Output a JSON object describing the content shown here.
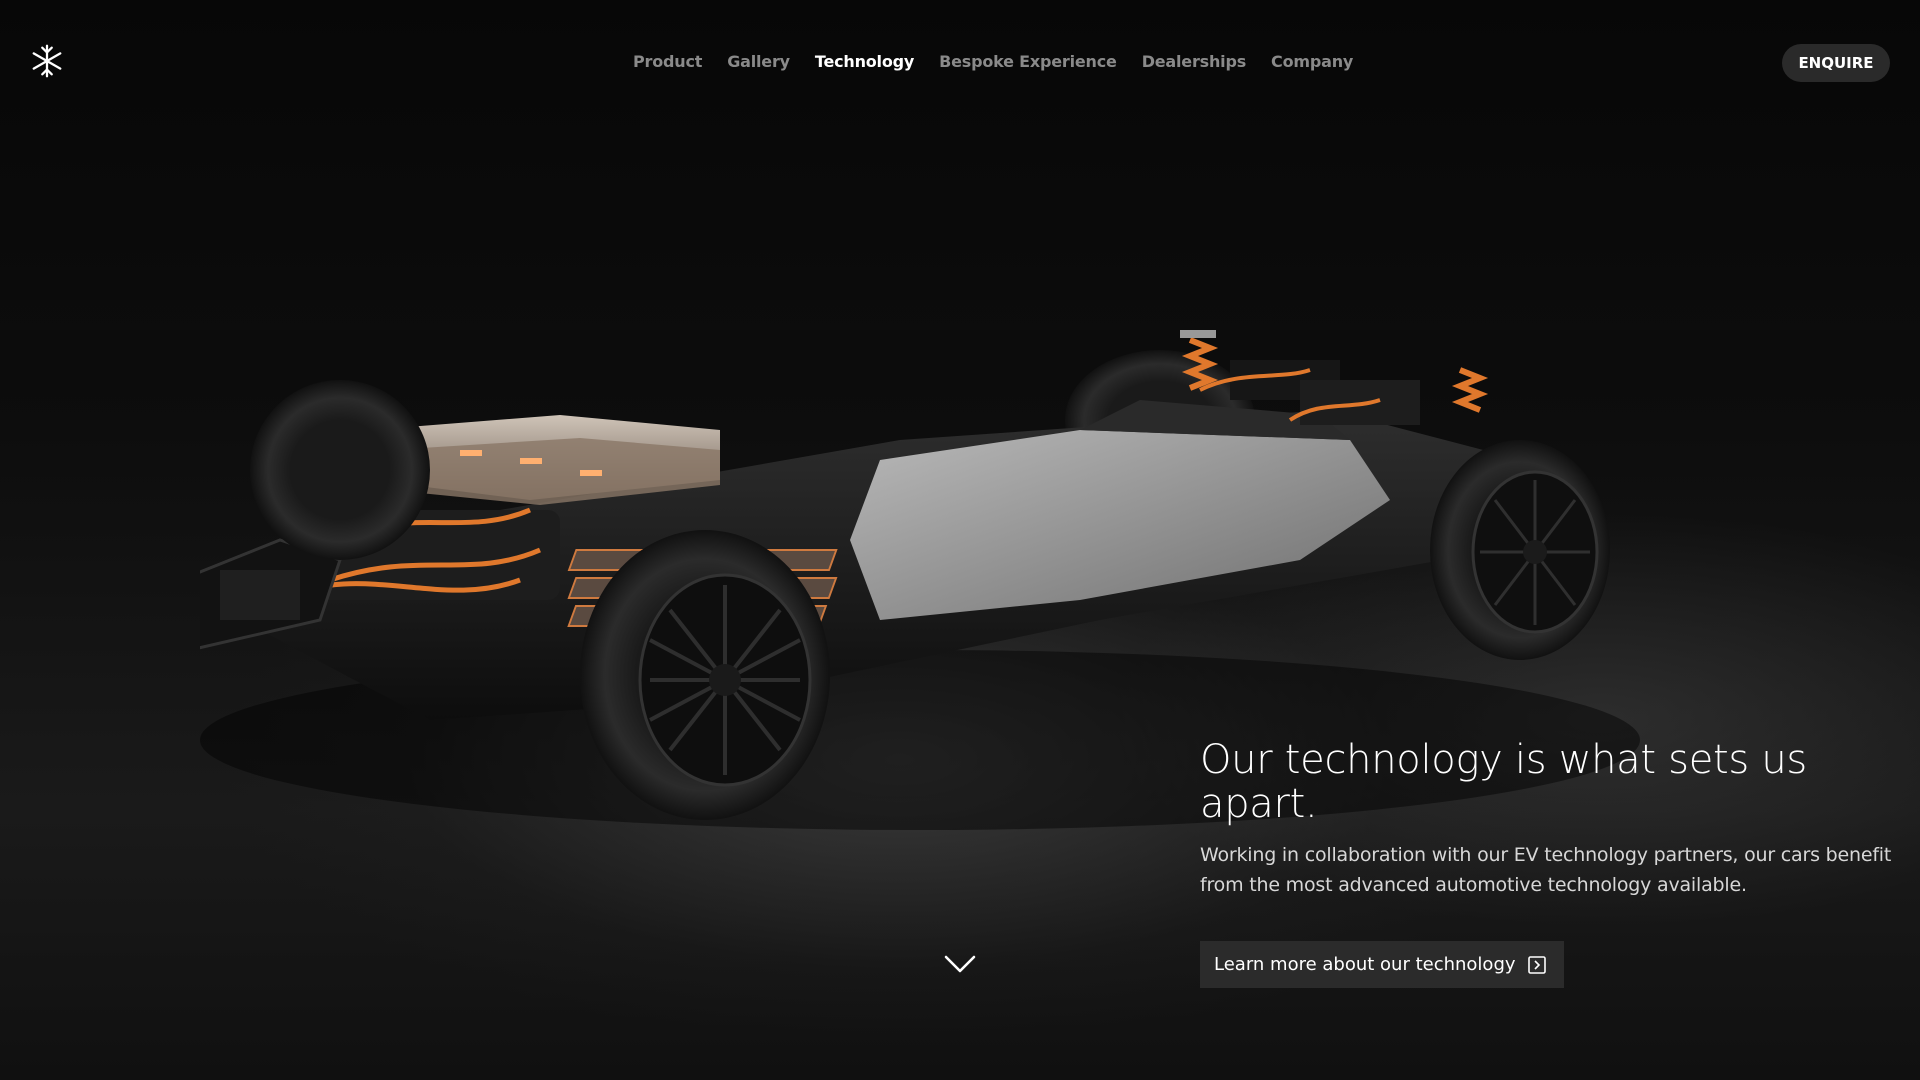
{
  "header": {
    "logo_icon": "snowflake-asterisk-logo-icon",
    "nav": [
      {
        "label": "Product",
        "active": false
      },
      {
        "label": "Gallery",
        "active": false
      },
      {
        "label": "Technology",
        "active": true
      },
      {
        "label": "Bespoke Experience",
        "active": false
      },
      {
        "label": "Dealerships",
        "active": false
      },
      {
        "label": "Company",
        "active": false
      }
    ],
    "enquire_label": "ENQUIRE"
  },
  "hero": {
    "headline": "Our technology is what sets us apart.",
    "subtext": "Working in collaboration with our EV technology partners, our cars benefit from the most advanced automotive technology available.",
    "cta_label": "Learn more about our technology",
    "cta_icon": "external-link-box-icon",
    "scroll_icon": "chevron-down-icon"
  },
  "colors": {
    "background": "#0b0b0b",
    "accent_copper": "#e0782c",
    "nav_inactive": "#8a8a8a",
    "button_bg": "#2b2b2b"
  }
}
